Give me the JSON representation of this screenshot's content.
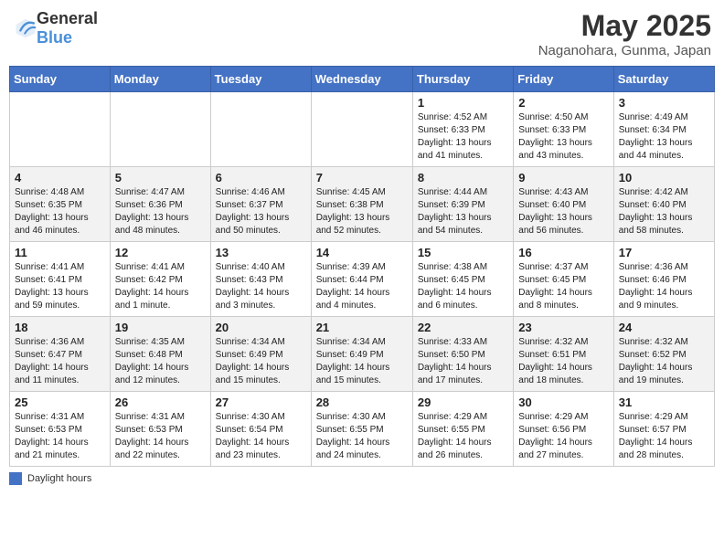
{
  "header": {
    "logo_general": "General",
    "logo_blue": "Blue",
    "month": "May 2025",
    "location": "Naganohara, Gunma, Japan"
  },
  "columns": [
    "Sunday",
    "Monday",
    "Tuesday",
    "Wednesday",
    "Thursday",
    "Friday",
    "Saturday"
  ],
  "weeks": [
    [
      {
        "day": "",
        "info": ""
      },
      {
        "day": "",
        "info": ""
      },
      {
        "day": "",
        "info": ""
      },
      {
        "day": "",
        "info": ""
      },
      {
        "day": "1",
        "info": "Sunrise: 4:52 AM\nSunset: 6:33 PM\nDaylight: 13 hours\nand 41 minutes."
      },
      {
        "day": "2",
        "info": "Sunrise: 4:50 AM\nSunset: 6:33 PM\nDaylight: 13 hours\nand 43 minutes."
      },
      {
        "day": "3",
        "info": "Sunrise: 4:49 AM\nSunset: 6:34 PM\nDaylight: 13 hours\nand 44 minutes."
      }
    ],
    [
      {
        "day": "4",
        "info": "Sunrise: 4:48 AM\nSunset: 6:35 PM\nDaylight: 13 hours\nand 46 minutes."
      },
      {
        "day": "5",
        "info": "Sunrise: 4:47 AM\nSunset: 6:36 PM\nDaylight: 13 hours\nand 48 minutes."
      },
      {
        "day": "6",
        "info": "Sunrise: 4:46 AM\nSunset: 6:37 PM\nDaylight: 13 hours\nand 50 minutes."
      },
      {
        "day": "7",
        "info": "Sunrise: 4:45 AM\nSunset: 6:38 PM\nDaylight: 13 hours\nand 52 minutes."
      },
      {
        "day": "8",
        "info": "Sunrise: 4:44 AM\nSunset: 6:39 PM\nDaylight: 13 hours\nand 54 minutes."
      },
      {
        "day": "9",
        "info": "Sunrise: 4:43 AM\nSunset: 6:40 PM\nDaylight: 13 hours\nand 56 minutes."
      },
      {
        "day": "10",
        "info": "Sunrise: 4:42 AM\nSunset: 6:40 PM\nDaylight: 13 hours\nand 58 minutes."
      }
    ],
    [
      {
        "day": "11",
        "info": "Sunrise: 4:41 AM\nSunset: 6:41 PM\nDaylight: 13 hours\nand 59 minutes."
      },
      {
        "day": "12",
        "info": "Sunrise: 4:41 AM\nSunset: 6:42 PM\nDaylight: 14 hours\nand 1 minute."
      },
      {
        "day": "13",
        "info": "Sunrise: 4:40 AM\nSunset: 6:43 PM\nDaylight: 14 hours\nand 3 minutes."
      },
      {
        "day": "14",
        "info": "Sunrise: 4:39 AM\nSunset: 6:44 PM\nDaylight: 14 hours\nand 4 minutes."
      },
      {
        "day": "15",
        "info": "Sunrise: 4:38 AM\nSunset: 6:45 PM\nDaylight: 14 hours\nand 6 minutes."
      },
      {
        "day": "16",
        "info": "Sunrise: 4:37 AM\nSunset: 6:45 PM\nDaylight: 14 hours\nand 8 minutes."
      },
      {
        "day": "17",
        "info": "Sunrise: 4:36 AM\nSunset: 6:46 PM\nDaylight: 14 hours\nand 9 minutes."
      }
    ],
    [
      {
        "day": "18",
        "info": "Sunrise: 4:36 AM\nSunset: 6:47 PM\nDaylight: 14 hours\nand 11 minutes."
      },
      {
        "day": "19",
        "info": "Sunrise: 4:35 AM\nSunset: 6:48 PM\nDaylight: 14 hours\nand 12 minutes."
      },
      {
        "day": "20",
        "info": "Sunrise: 4:34 AM\nSunset: 6:49 PM\nDaylight: 14 hours\nand 15 minutes."
      },
      {
        "day": "21",
        "info": "Sunrise: 4:34 AM\nSunset: 6:49 PM\nDaylight: 14 hours\nand 15 minutes."
      },
      {
        "day": "22",
        "info": "Sunrise: 4:33 AM\nSunset: 6:50 PM\nDaylight: 14 hours\nand 17 minutes."
      },
      {
        "day": "23",
        "info": "Sunrise: 4:32 AM\nSunset: 6:51 PM\nDaylight: 14 hours\nand 18 minutes."
      },
      {
        "day": "24",
        "info": "Sunrise: 4:32 AM\nSunset: 6:52 PM\nDaylight: 14 hours\nand 19 minutes."
      }
    ],
    [
      {
        "day": "25",
        "info": "Sunrise: 4:31 AM\nSunset: 6:53 PM\nDaylight: 14 hours\nand 21 minutes."
      },
      {
        "day": "26",
        "info": "Sunrise: 4:31 AM\nSunset: 6:53 PM\nDaylight: 14 hours\nand 22 minutes."
      },
      {
        "day": "27",
        "info": "Sunrise: 4:30 AM\nSunset: 6:54 PM\nDaylight: 14 hours\nand 23 minutes."
      },
      {
        "day": "28",
        "info": "Sunrise: 4:30 AM\nSunset: 6:55 PM\nDaylight: 14 hours\nand 24 minutes."
      },
      {
        "day": "29",
        "info": "Sunrise: 4:29 AM\nSunset: 6:55 PM\nDaylight: 14 hours\nand 26 minutes."
      },
      {
        "day": "30",
        "info": "Sunrise: 4:29 AM\nSunset: 6:56 PM\nDaylight: 14 hours\nand 27 minutes."
      },
      {
        "day": "31",
        "info": "Sunrise: 4:29 AM\nSunset: 6:57 PM\nDaylight: 14 hours\nand 28 minutes."
      }
    ]
  ],
  "footer": {
    "legend_label": "Daylight hours"
  }
}
